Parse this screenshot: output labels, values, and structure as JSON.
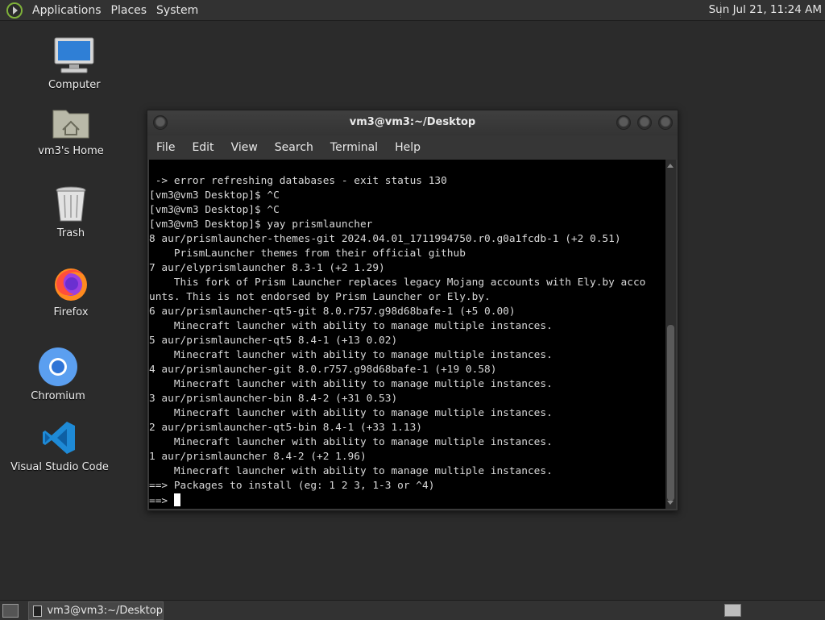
{
  "top_panel": {
    "menus": [
      "Applications",
      "Places",
      "System"
    ],
    "clock": "Sun Jul 21, 11:24 AM"
  },
  "desktop_icons": [
    {
      "label": "Computer",
      "icon": "computer-icon"
    },
    {
      "label": "vm3's Home",
      "icon": "home-folder-icon"
    },
    {
      "label": "Trash",
      "icon": "trash-icon"
    },
    {
      "label": "Firefox",
      "icon": "firefox-icon"
    },
    {
      "label": "Chromium",
      "icon": "chromium-icon"
    },
    {
      "label": "Visual Studio Code",
      "icon": "vscode-icon"
    }
  ],
  "window": {
    "title": "vm3@vm3:~/Desktop",
    "menu": [
      "File",
      "Edit",
      "View",
      "Search",
      "Terminal",
      "Help"
    ]
  },
  "terminal": {
    "lines": [
      " -> error refreshing databases - exit status 130",
      "[vm3@vm3 Desktop]$ ^C",
      "[vm3@vm3 Desktop]$ ^C",
      "[vm3@vm3 Desktop]$ yay prismlauncher",
      "8 aur/prismlauncher-themes-git 2024.04.01_1711994750.r0.g0a1fcdb-1 (+2 0.51)",
      "    PrismLauncher themes from their official github",
      "7 aur/elyprismlauncher 8.3-1 (+2 1.29)",
      "    This fork of Prism Launcher replaces legacy Mojang accounts with Ely.by acco",
      "unts. This is not endorsed by Prism Launcher or Ely.by.",
      "6 aur/prismlauncher-qt5-git 8.0.r757.g98d68bafe-1 (+5 0.00)",
      "    Minecraft launcher with ability to manage multiple instances.",
      "5 aur/prismlauncher-qt5 8.4-1 (+13 0.02)",
      "    Minecraft launcher with ability to manage multiple instances.",
      "4 aur/prismlauncher-git 8.0.r757.g98d68bafe-1 (+19 0.58)",
      "    Minecraft launcher with ability to manage multiple instances.",
      "3 aur/prismlauncher-bin 8.4-2 (+31 0.53)",
      "    Minecraft launcher with ability to manage multiple instances.",
      "2 aur/prismlauncher-qt5-bin 8.4-1 (+33 1.13)",
      "    Minecraft launcher with ability to manage multiple instances.",
      "1 aur/prismlauncher 8.4-2 (+2 1.96)",
      "    Minecraft launcher with ability to manage multiple instances.",
      "==> Packages to install (eg: 1 2 3, 1-3 or ^4)"
    ],
    "prompt": "==> "
  },
  "bottom_panel": {
    "task_label": "vm3@vm3:~/Desktop"
  }
}
